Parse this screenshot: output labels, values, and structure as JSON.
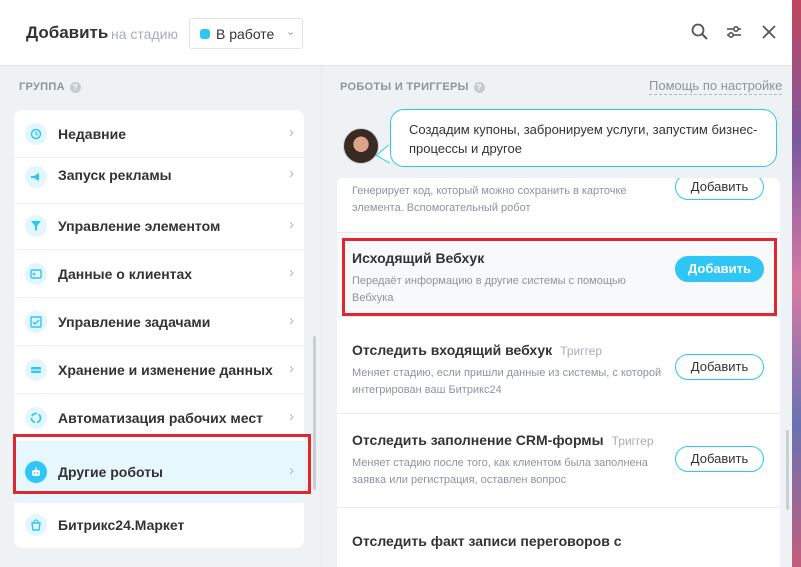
{
  "header": {
    "title": "Добавить",
    "stage_label": "на стадию",
    "stage_value": "В работе",
    "stage_color": "#2fc6f6",
    "icons": [
      "search-icon",
      "settings-icon",
      "close-icon"
    ]
  },
  "left": {
    "section_label": "ГРУППА",
    "items": [
      {
        "label": "Недавние",
        "icon": "history-icon"
      },
      {
        "label": "Запуск рекламы",
        "icon": "megaphone-icon"
      },
      {
        "label": "Управление элементом",
        "icon": "filter-icon"
      },
      {
        "label": "Данные о клиентах",
        "icon": "contact-card-icon"
      },
      {
        "label": "Управление задачами",
        "icon": "task-icon"
      },
      {
        "label": "Хранение и изменение данных",
        "icon": "storage-icon"
      },
      {
        "label": "Автоматизация рабочих мест",
        "icon": "automation-icon"
      },
      {
        "label": "Другие роботы",
        "icon": "robot-icon"
      }
    ],
    "market_label": "Битрикс24.Маркет"
  },
  "right": {
    "section_label": "РОБОТЫ И ТРИГГЕРЫ",
    "help_link": "Помощь по настройке",
    "bubble_text": "Создадим купоны, забронируем услуги, запустим бизнес-процессы и другое",
    "robots": [
      {
        "title": "",
        "tag": "",
        "desc": "Генерирует код, который можно сохранить в карточке элемента. Вспомогательный робот",
        "button": "Добавить"
      },
      {
        "title": "Исходящий Вебхук",
        "tag": "",
        "desc": "Передаёт информацию в другие системы с помощью Вебхука",
        "button": "Добавить"
      },
      {
        "title": "Отследить входящий вебхук",
        "tag": "Триггер",
        "desc": "Меняет стадию, если пришли данные из системы, с которой интегрирован ваш Битрикс24",
        "button": "Добавить"
      },
      {
        "title": "Отследить заполнение CRM-формы",
        "tag": "Триггер",
        "desc": "Меняет стадию после того, как клиентом была заполнена заявка или регистрация, оставлен вопрос",
        "button": "Добавить"
      },
      {
        "title": "Отследить факт записи переговоров с",
        "tag": "",
        "desc": "",
        "button": ""
      }
    ]
  },
  "colors": {
    "accent": "#2fc6f6",
    "highlight": "#e0262f"
  }
}
